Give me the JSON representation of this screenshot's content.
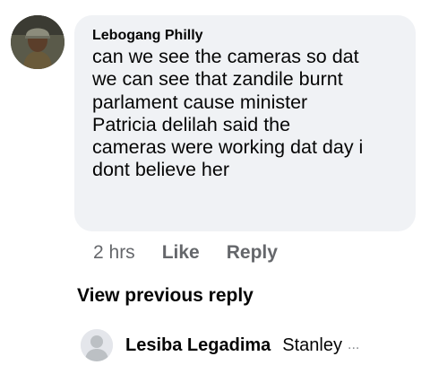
{
  "comment": {
    "author": "Lebogang Philly",
    "text_lines": [
      "can we see the cameras so dat",
      "we can see that zandile burnt",
      "parlament cause minister",
      "Patricia delilah said the",
      "cameras were working dat day i",
      "dont believe her"
    ],
    "time": "2 hrs",
    "like_label": "Like",
    "reply_label": "Reply"
  },
  "view_previous_label": "View previous reply",
  "reply": {
    "author": "Lesiba Legadima",
    "snippet": "Stanley",
    "ellipsis": "..."
  },
  "colors": {
    "bubble_bg": "#f0f2f5",
    "text_primary": "#050505",
    "text_secondary": "#65676b",
    "placeholder_avatar": "#e4e6eb"
  },
  "icons": {
    "comment_avatar": "user-photo-avatar",
    "reply_avatar": "default-user-silhouette-icon"
  }
}
